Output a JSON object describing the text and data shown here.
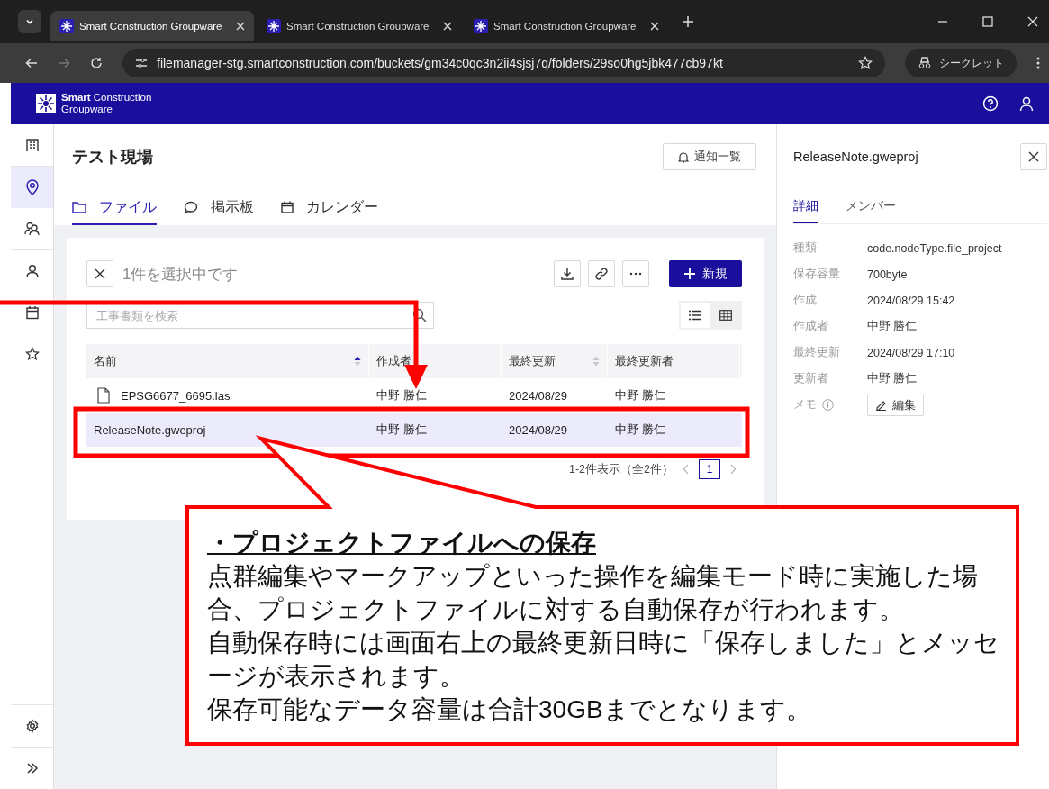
{
  "browser": {
    "tabs": [
      {
        "title": "Smart Construction Groupware",
        "selected": true
      },
      {
        "title": "Smart Construction Groupware",
        "selected": false
      },
      {
        "title": "Smart Construction Groupware",
        "selected": false
      }
    ],
    "url": "filemanager-stg.smartconstruction.com/buckets/gm34c0qc3n2ii4sjsj7q/folders/29so0hg5jbk477cb97kt",
    "profile": "シークレット"
  },
  "app_header": {
    "logo_line1": "**Smart** Construction",
    "logo_line2": "Groupware"
  },
  "sidebar": {
    "items": [
      {
        "selected": false
      },
      {
        "selected": true
      },
      {
        "selected": false
      },
      {
        "selected": false
      },
      {
        "selected": false
      },
      {
        "selected": false
      }
    ]
  },
  "main": {
    "title": "テスト現場",
    "notify_button": "通知一覧",
    "tabs": [
      {
        "label": "ファイル",
        "selected": true
      },
      {
        "label": "掲示板",
        "selected": false
      },
      {
        "label": "カレンダー",
        "selected": false
      }
    ],
    "selection_text": "1件を選択中です",
    "new_button": "新規",
    "search": {
      "placeholder": "工事書類を検索"
    },
    "views": [
      {
        "selected": true
      },
      {
        "selected": false
      }
    ],
    "table": {
      "columns": [
        {
          "label": "名前",
          "sortable": true,
          "sorted": true
        },
        {
          "label": "作成者",
          "sortable": false,
          "sorted": false
        },
        {
          "label": "最終更新",
          "sortable": true,
          "sorted": false
        },
        {
          "label": "最終更新者",
          "sortable": false,
          "sorted": false
        }
      ],
      "rows": [
        {
          "kind": "file",
          "selected": false,
          "cells": [
            "EPSG6677_6695.las",
            "中野 勝仁",
            "2024/08/29",
            "中野 勝仁"
          ]
        },
        {
          "kind": "project",
          "selected": true,
          "cells": [
            "ReleaseNote.gweproj",
            "中野 勝仁",
            "2024/08/29",
            "中野 勝仁"
          ]
        }
      ]
    },
    "pagination": {
      "summary": "1-2件表示（全2件）",
      "pages": [
        {
          "label": "1",
          "selected": true
        }
      ]
    }
  },
  "detail_panel": {
    "title": "ReleaseNote.gweproj",
    "tabs": [
      {
        "label": "詳細",
        "selected": true
      },
      {
        "label": "メンバー",
        "selected": false
      }
    ],
    "fields": [
      {
        "label": "種類",
        "value": "code.nodeType.file_project"
      },
      {
        "label": "保存容量",
        "value": "700byte"
      },
      {
        "label": "作成",
        "value": "2024/08/29 15:42"
      },
      {
        "label": "作成者",
        "value": "中野 勝仁"
      },
      {
        "label": "最終更新",
        "value": "2024/08/29 17:10"
      },
      {
        "label": "更新者",
        "value": "中野 勝仁"
      }
    ],
    "memo_label": "メモ",
    "edit_button": "編集"
  },
  "callout": {
    "heading": "・プロジェクトファイルへの保存",
    "paragraphs": [
      "点群編集やマークアップといった操作を編集モード時に実施した場合、プロジェクトファイルに対する自動保存が行われます。",
      "自動保存時には画面右上の最終更新日時に「保存しました」とメッセージが表示されます。",
      "保存可能なデータ容量は合計30GBまでとなります。"
    ]
  }
}
